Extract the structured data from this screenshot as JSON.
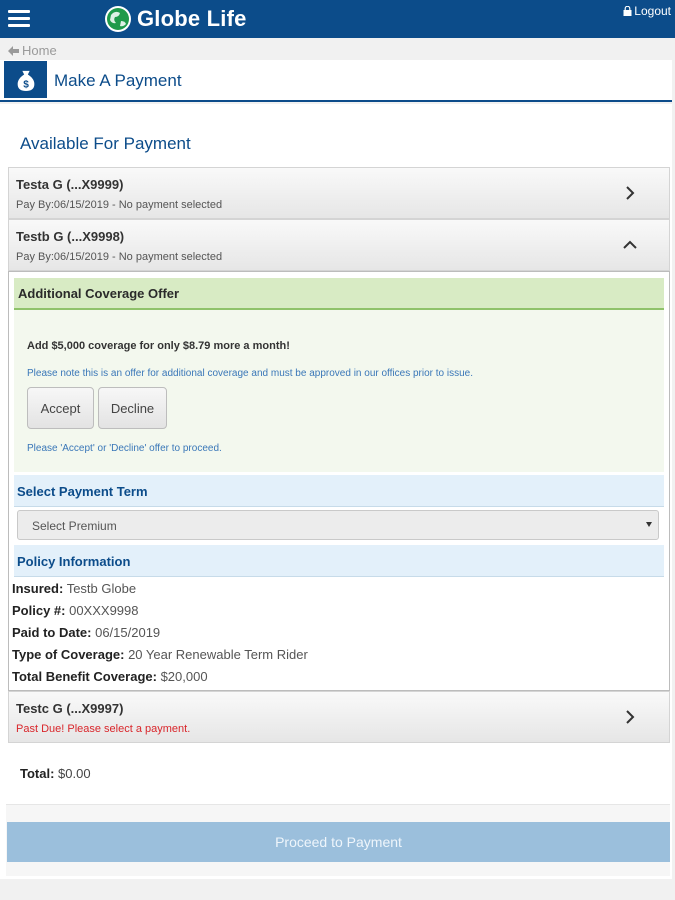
{
  "header": {
    "brand": "Globe Life",
    "logout_label": "Logout"
  },
  "breadcrumb": {
    "home_label": "Home"
  },
  "page": {
    "title": "Make A Payment",
    "section_title": "Available For Payment"
  },
  "policies": [
    {
      "name": "Testa G (...X9999)",
      "status": "Pay By:06/15/2019 - No payment selected",
      "expanded": false
    },
    {
      "name": "Testb G (...X9998)",
      "status": "Pay By:06/15/2019 - No payment selected",
      "expanded": true
    },
    {
      "name": "Testc G (...X9997)",
      "status": "Past Due! Please select a payment.",
      "expanded": false,
      "past_due": true
    }
  ],
  "offer": {
    "heading": "Additional Coverage Offer",
    "line": "Add $5,000 coverage for only $8.79 more a month!",
    "note": "Please note this is an offer for additional coverage and must be approved in our offices prior to issue.",
    "accept_label": "Accept",
    "decline_label": "Decline",
    "prompt": "Please 'Accept' or 'Decline' offer to proceed."
  },
  "payment_term": {
    "heading": "Select Payment Term",
    "select_value": "Select Premium"
  },
  "policy_info": {
    "heading": "Policy Information",
    "rows": [
      {
        "label": "Insured:",
        "value": "Testb Globe"
      },
      {
        "label": "Policy #:",
        "value": "00XXX9998"
      },
      {
        "label": "Paid to Date:",
        "value": "06/15/2019"
      },
      {
        "label": "Type of Coverage:",
        "value": "20 Year Renewable Term Rider"
      },
      {
        "label": "Total Benefit Coverage:",
        "value": "$20,000"
      }
    ]
  },
  "total": {
    "label": "Total:",
    "value": "$0.00"
  },
  "proceed_label": "Proceed to Payment",
  "colors": {
    "brand_blue": "#0c4c8a",
    "offer_green": "#d8ebc4",
    "past_due_red": "#d9262b",
    "proceed_disabled": "#9bbfdc"
  }
}
